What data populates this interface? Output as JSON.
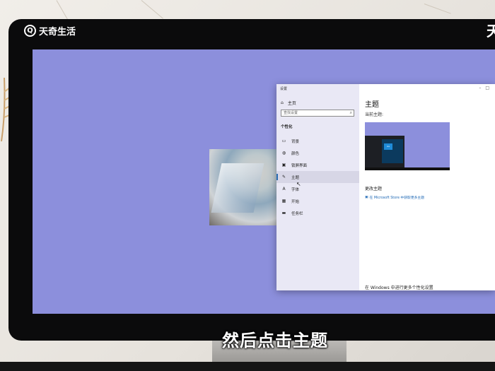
{
  "overlay": {
    "brand": "天奇生活",
    "brand_icon": "Q",
    "corner_text": "天",
    "caption": "然后点击主题"
  },
  "settings_window": {
    "title": "设置",
    "home_label": "主页",
    "search_placeholder": "查找设置",
    "section_title": "个性化",
    "nav_items": [
      {
        "label": "背景",
        "icon": "picture-icon",
        "glyph": "▭"
      },
      {
        "label": "颜色",
        "icon": "palette-icon",
        "glyph": "◍"
      },
      {
        "label": "锁屏界面",
        "icon": "lock-screen-icon",
        "glyph": "▣"
      },
      {
        "label": "主题",
        "icon": "theme-icon",
        "glyph": "✎",
        "active": true
      },
      {
        "label": "字体",
        "icon": "font-icon",
        "glyph": "A"
      },
      {
        "label": "开始",
        "icon": "start-icon",
        "glyph": "▦"
      },
      {
        "label": "任务栏",
        "icon": "taskbar-icon",
        "glyph": "▬"
      }
    ],
    "main": {
      "title": "主题",
      "current_theme_label": "当前主题:",
      "preview_tile": "Aa",
      "change_theme_label": "更改主题",
      "store_link": "在 Microsoft Store 中获取更多主题",
      "more_settings": "在 Windows 中进行更多个性化设置"
    }
  },
  "colors": {
    "desktop": "#8c8fdc",
    "nav_background": "#e9e8f5",
    "accent": "#2a6db4",
    "link": "#1e68b5"
  }
}
